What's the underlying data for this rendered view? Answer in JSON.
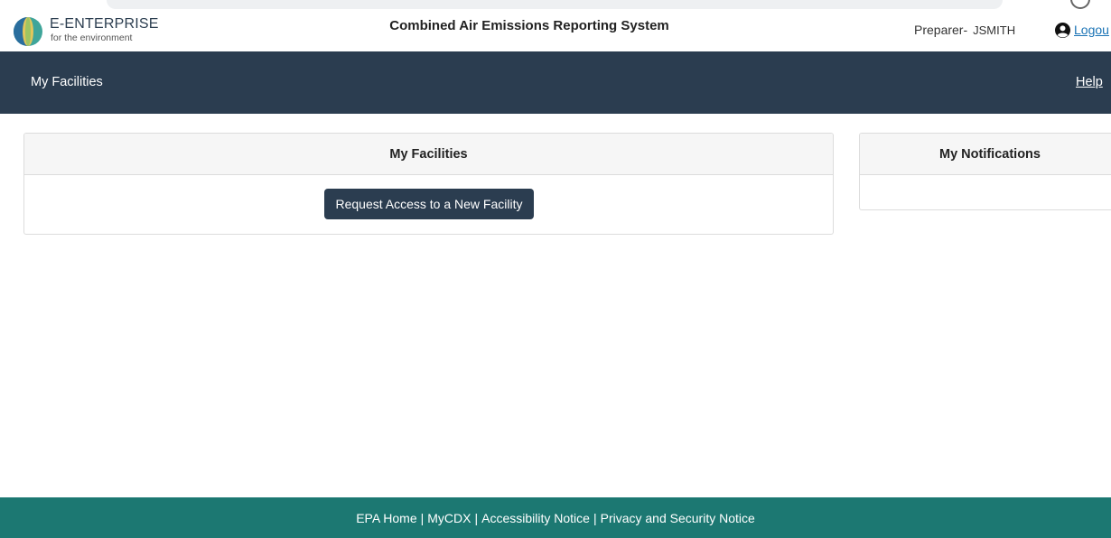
{
  "brand": {
    "name": "E-ENTERPRISE",
    "tagline": "for the environment",
    "logo_icon": "e-enterprise-logo-icon"
  },
  "header": {
    "system_title": "Combined Air Emissions Reporting System",
    "role_label": "Preparer-",
    "username": "JSMITH",
    "logout_label": "Logou",
    "user_icon": "user-circle-icon"
  },
  "nav": {
    "title": "My Facilities",
    "help_label": "Help"
  },
  "facilities_card": {
    "title": "My Facilities",
    "request_button_label": "Request Access to a New Facility"
  },
  "notifications_card": {
    "title": "My Notifications"
  },
  "footer": {
    "links": [
      "EPA Home",
      "MyCDX",
      "Accessibility Notice",
      "Privacy and Security Notice"
    ],
    "separator": "|"
  },
  "colors": {
    "nav_bg": "#2b3d50",
    "footer_bg": "#1c7872",
    "link": "#1a73b5",
    "button_bg": "#2b3d50"
  }
}
